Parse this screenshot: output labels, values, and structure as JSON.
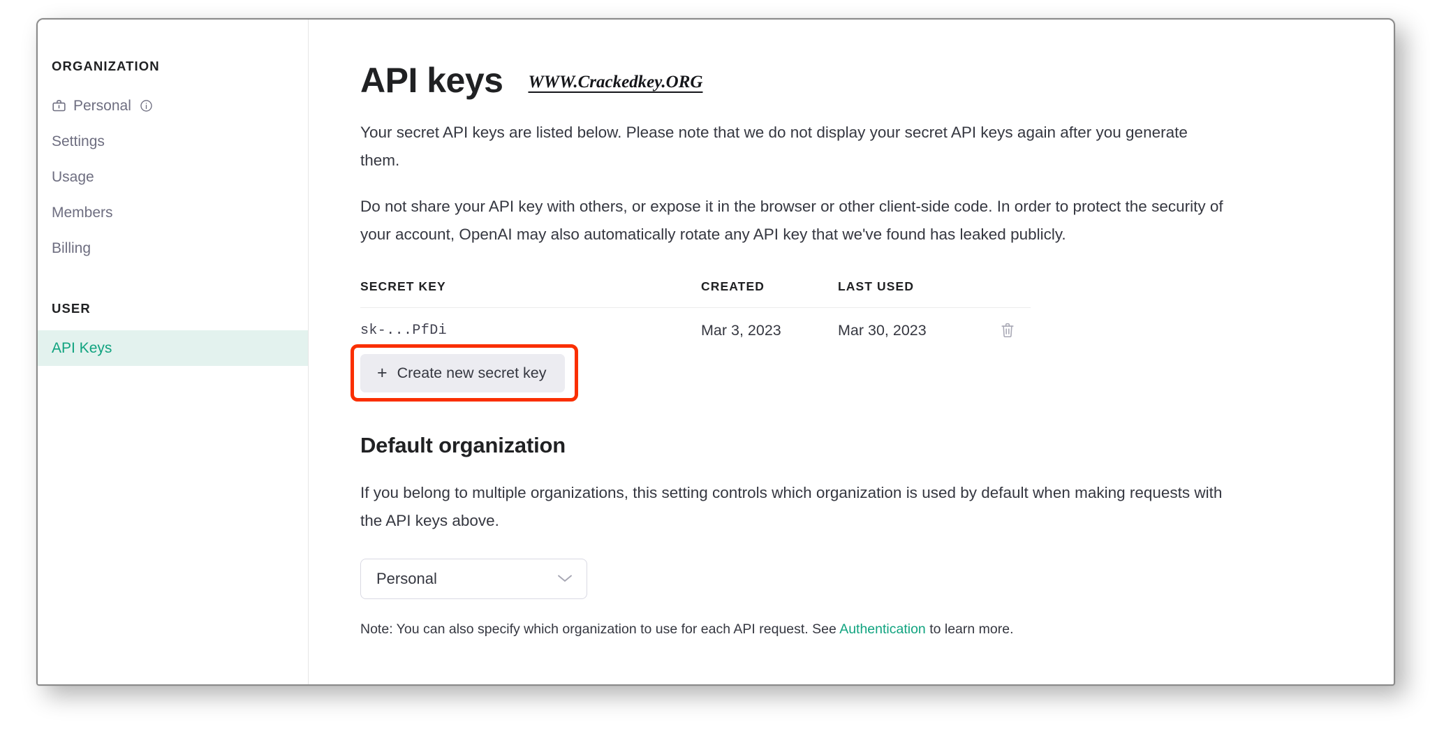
{
  "sidebar": {
    "org_heading": "ORGANIZATION",
    "org_items": [
      {
        "label": "Personal",
        "icon": "briefcase-icon",
        "trailing_icon": "info-icon",
        "active": false
      },
      {
        "label": "Settings",
        "active": false
      },
      {
        "label": "Usage",
        "active": false
      },
      {
        "label": "Members",
        "active": false
      },
      {
        "label": "Billing",
        "active": false
      }
    ],
    "user_heading": "USER",
    "user_items": [
      {
        "label": "API Keys",
        "active": true
      }
    ]
  },
  "main": {
    "title": "API keys",
    "watermark": "WWW.Crackedkey.ORG",
    "paragraph_1": "Your secret API keys are listed below. Please note that we do not display your secret API keys again after you generate them.",
    "paragraph_2": "Do not share your API key with others, or expose it in the browser or other client-side code. In order to protect the security of your account, OpenAI may also automatically rotate any API key that we've found has leaked publicly.",
    "table": {
      "columns": [
        "SECRET KEY",
        "CREATED",
        "LAST USED",
        ""
      ],
      "rows": [
        {
          "secret_key": "sk-...PfDi",
          "created": "Mar 3, 2023",
          "last_used": "Mar 30, 2023",
          "action_icon": "trash-icon"
        }
      ]
    },
    "create_button": {
      "label": "Create new secret key",
      "plus": "+"
    },
    "default_org": {
      "heading": "Default organization",
      "description": "If you belong to multiple organizations, this setting controls which organization is used by default when making requests with the API keys above.",
      "select_value": "Personal",
      "note_before": "Note: You can also specify which organization to use for each API request. See ",
      "note_link": "Authentication",
      "note_after": " to learn more."
    }
  },
  "colors": {
    "accent_green": "#10a37f",
    "active_bg": "#e3f2ee",
    "annotation_red": "#fa2f00",
    "button_bg": "#ececf1",
    "text_primary": "#202123",
    "text_body": "#353740",
    "text_muted": "#6e6e80"
  }
}
